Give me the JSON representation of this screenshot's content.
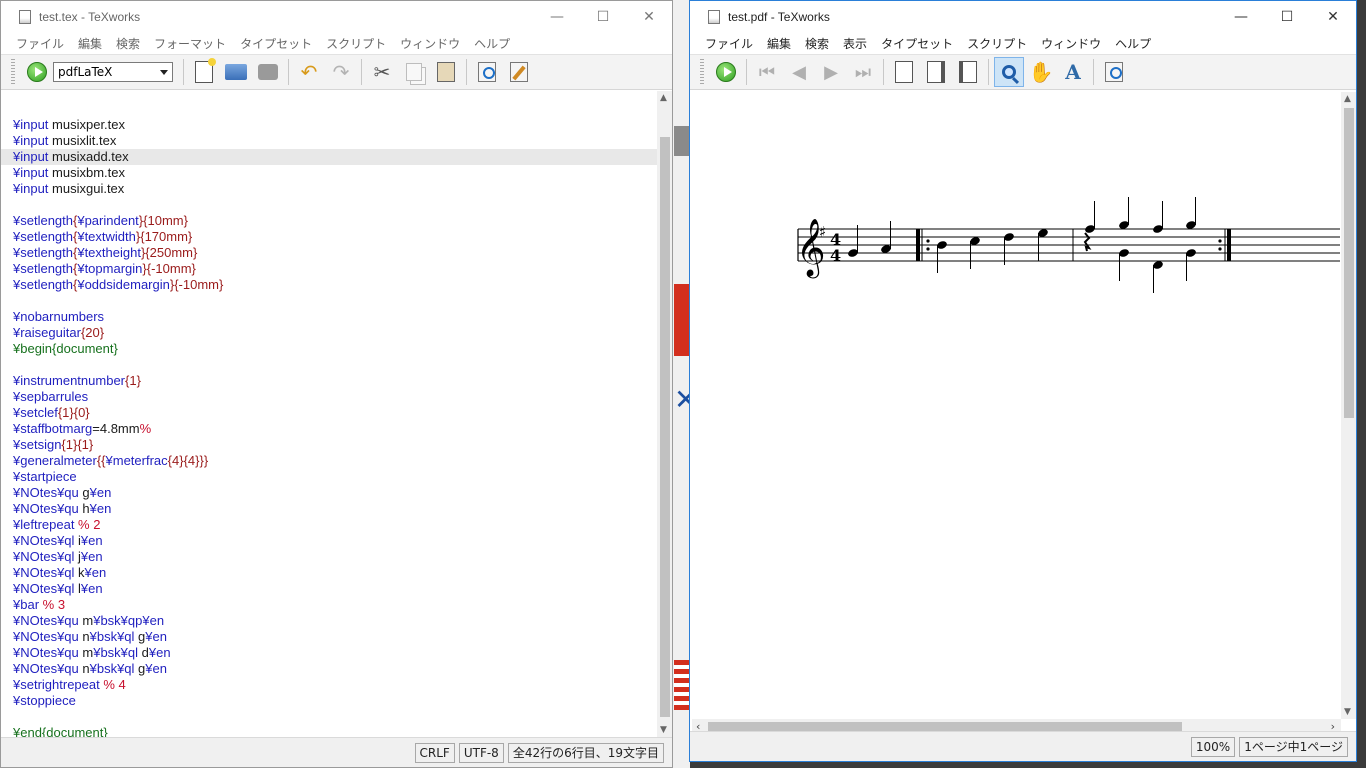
{
  "editor_window": {
    "title": "test.tex - TeXworks",
    "menu": [
      "ファイル",
      "編集",
      "検索",
      "フォーマット",
      "タイプセット",
      "スクリプト",
      "ウィンドウ",
      "ヘルプ"
    ],
    "engine": "pdfLaTeX",
    "status": {
      "line_ending": "CRLF",
      "encoding": "UTF-8",
      "position": "全42行の6行目、19文字目"
    },
    "lines": [
      [
        [
          "cs",
          "¥input"
        ],
        [
          "t",
          " musixper.tex"
        ]
      ],
      [
        [
          "cs",
          "¥input"
        ],
        [
          "t",
          " musixlit.tex"
        ]
      ],
      [
        [
          "cs",
          "¥input"
        ],
        [
          "t",
          " musixadd.tex"
        ]
      ],
      [
        [
          "cs",
          "¥input"
        ],
        [
          "t",
          " musixbm.tex"
        ]
      ],
      [
        [
          "cs",
          "¥input"
        ],
        [
          "t",
          " musixgui.tex"
        ]
      ],
      [],
      [
        [
          "cs",
          "¥setlength"
        ],
        [
          "arg",
          "{"
        ],
        [
          "cs",
          "¥parindent"
        ],
        [
          "arg",
          "}{10mm}"
        ]
      ],
      [
        [
          "cs",
          "¥setlength"
        ],
        [
          "arg",
          "{"
        ],
        [
          "cs",
          "¥textwidth"
        ],
        [
          "arg",
          "}{170mm}"
        ]
      ],
      [
        [
          "cs",
          "¥setlength"
        ],
        [
          "arg",
          "{"
        ],
        [
          "cs",
          "¥textheight"
        ],
        [
          "arg",
          "}{250mm}"
        ]
      ],
      [
        [
          "cs",
          "¥setlength"
        ],
        [
          "arg",
          "{"
        ],
        [
          "cs",
          "¥topmargin"
        ],
        [
          "arg",
          "}{-10mm}"
        ]
      ],
      [
        [
          "cs",
          "¥setlength"
        ],
        [
          "arg",
          "{"
        ],
        [
          "cs",
          "¥oddsidemargin"
        ],
        [
          "arg",
          "}{-10mm}"
        ]
      ],
      [],
      [
        [
          "cs",
          "¥nobarnumbers"
        ]
      ],
      [
        [
          "cs",
          "¥raiseguitar"
        ],
        [
          "arg",
          "{20}"
        ]
      ],
      [
        [
          "env",
          "¥begin{document}"
        ]
      ],
      [],
      [
        [
          "cs",
          "¥instrumentnumber"
        ],
        [
          "arg",
          "{1}"
        ]
      ],
      [
        [
          "cs",
          "¥sepbarrules"
        ]
      ],
      [
        [
          "cs",
          "¥setclef"
        ],
        [
          "arg",
          "{1}{0}"
        ]
      ],
      [
        [
          "cs",
          "¥staffbotmarg"
        ],
        [
          "t",
          "=4.8mm"
        ],
        [
          "cmt",
          "%"
        ]
      ],
      [
        [
          "cs",
          "¥setsign"
        ],
        [
          "arg",
          "{1}{1}"
        ]
      ],
      [
        [
          "cs",
          "¥generalmeter"
        ],
        [
          "arg",
          "{{"
        ],
        [
          "cs",
          "¥meterfrac"
        ],
        [
          "arg",
          "{4}{4}}}"
        ]
      ],
      [
        [
          "cs",
          "¥startpiece"
        ]
      ],
      [
        [
          "cs",
          "¥NOtes¥qu"
        ],
        [
          "t",
          " g"
        ],
        [
          "cs",
          "¥en"
        ]
      ],
      [
        [
          "cs",
          "¥NOtes¥qu"
        ],
        [
          "t",
          " h"
        ],
        [
          "cs",
          "¥en"
        ]
      ],
      [
        [
          "cs",
          "¥leftrepeat"
        ],
        [
          "cmt",
          " % 2"
        ]
      ],
      [
        [
          "cs",
          "¥NOtes¥ql"
        ],
        [
          "t",
          " i"
        ],
        [
          "cs",
          "¥en"
        ]
      ],
      [
        [
          "cs",
          "¥NOtes¥ql"
        ],
        [
          "t",
          " j"
        ],
        [
          "cs",
          "¥en"
        ]
      ],
      [
        [
          "cs",
          "¥NOtes¥ql"
        ],
        [
          "t",
          " k"
        ],
        [
          "cs",
          "¥en"
        ]
      ],
      [
        [
          "cs",
          "¥NOtes¥ql"
        ],
        [
          "t",
          " l"
        ],
        [
          "cs",
          "¥en"
        ]
      ],
      [
        [
          "cs",
          "¥bar"
        ],
        [
          "cmt",
          " % 3"
        ]
      ],
      [
        [
          "cs",
          "¥NOtes¥qu"
        ],
        [
          "t",
          " m"
        ],
        [
          "cs",
          "¥bsk¥qp¥en"
        ]
      ],
      [
        [
          "cs",
          "¥NOtes¥qu"
        ],
        [
          "t",
          " n"
        ],
        [
          "cs",
          "¥bsk¥ql"
        ],
        [
          "t",
          " g"
        ],
        [
          "cs",
          "¥en"
        ]
      ],
      [
        [
          "cs",
          "¥NOtes¥qu"
        ],
        [
          "t",
          " m"
        ],
        [
          "cs",
          "¥bsk¥ql"
        ],
        [
          "t",
          " d"
        ],
        [
          "cs",
          "¥en"
        ]
      ],
      [
        [
          "cs",
          "¥NOtes¥qu"
        ],
        [
          "t",
          " n"
        ],
        [
          "cs",
          "¥bsk¥ql"
        ],
        [
          "t",
          " g"
        ],
        [
          "cs",
          "¥en"
        ]
      ],
      [
        [
          "cs",
          "¥setrightrepeat"
        ],
        [
          "cmt",
          " % 4"
        ]
      ],
      [
        [
          "cs",
          "¥stoppiece"
        ]
      ],
      [],
      [
        [
          "env",
          "¥end{document}"
        ]
      ]
    ],
    "highlighted_line": 2
  },
  "viewer_window": {
    "title": "test.pdf - TeXworks",
    "menu": [
      "ファイル",
      "編集",
      "検索",
      "表示",
      "タイプセット",
      "スクリプト",
      "ウィンドウ",
      "ヘルプ"
    ],
    "status": {
      "zoom": "100%",
      "page": "1ページ中1ページ"
    }
  },
  "window_controls": {
    "minimize": "—",
    "maximize": "☐",
    "close": "✕"
  }
}
